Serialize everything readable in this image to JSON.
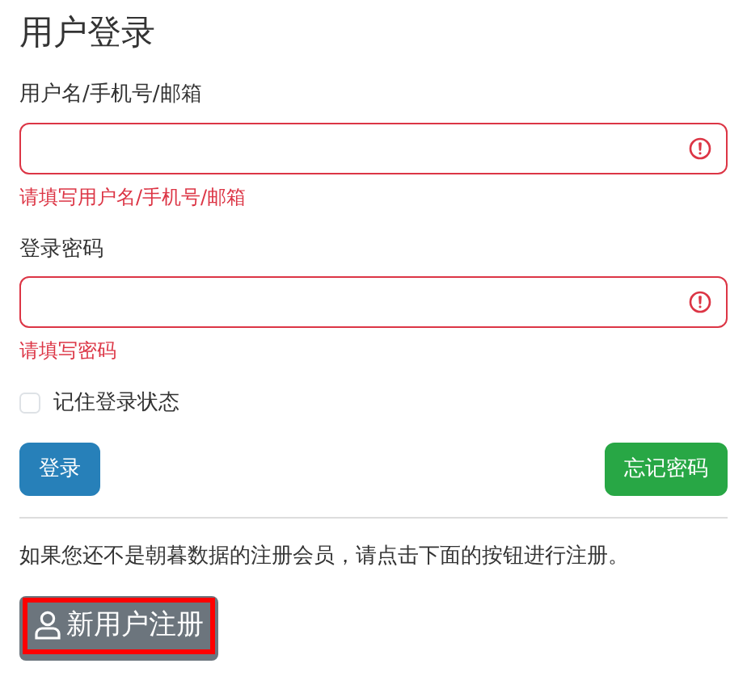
{
  "title": "用户登录",
  "fields": [
    {
      "label": "用户名/手机号/邮箱",
      "invalid": true,
      "error": "请填写用户名/手机号/邮箱"
    },
    {
      "label": "登录密码",
      "invalid": true,
      "error": "请填写密码"
    }
  ],
  "remember": {
    "label": "记住登录状态",
    "checked": false
  },
  "buttons": [
    {
      "label": "登录",
      "kind": "primary"
    },
    {
      "label": "忘记密码",
      "kind": "success"
    }
  ],
  "notice": "如果您还不是朝暮数据的注册会员，请点击下面的按钮进行注册。",
  "register_button": {
    "label": "新用户注册",
    "highlighted": true
  }
}
